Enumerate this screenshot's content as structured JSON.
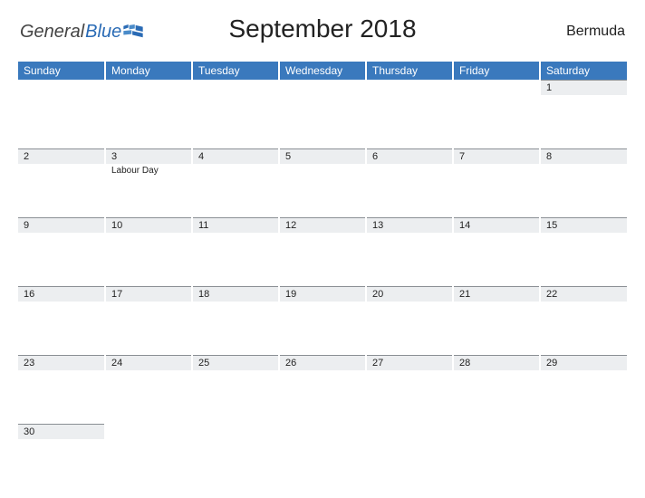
{
  "logo": {
    "text1": "General",
    "text2": "Blue"
  },
  "title": "September 2018",
  "region": "Bermuda",
  "dayHeaders": [
    "Sunday",
    "Monday",
    "Tuesday",
    "Wednesday",
    "Thursday",
    "Friday",
    "Saturday"
  ],
  "weeks": [
    [
      {
        "n": ""
      },
      {
        "n": ""
      },
      {
        "n": ""
      },
      {
        "n": ""
      },
      {
        "n": ""
      },
      {
        "n": ""
      },
      {
        "n": "1"
      }
    ],
    [
      {
        "n": "2"
      },
      {
        "n": "3",
        "event": "Labour Day"
      },
      {
        "n": "4"
      },
      {
        "n": "5"
      },
      {
        "n": "6"
      },
      {
        "n": "7"
      },
      {
        "n": "8"
      }
    ],
    [
      {
        "n": "9"
      },
      {
        "n": "10"
      },
      {
        "n": "11"
      },
      {
        "n": "12"
      },
      {
        "n": "13"
      },
      {
        "n": "14"
      },
      {
        "n": "15"
      }
    ],
    [
      {
        "n": "16"
      },
      {
        "n": "17"
      },
      {
        "n": "18"
      },
      {
        "n": "19"
      },
      {
        "n": "20"
      },
      {
        "n": "21"
      },
      {
        "n": "22"
      }
    ],
    [
      {
        "n": "23"
      },
      {
        "n": "24"
      },
      {
        "n": "25"
      },
      {
        "n": "26"
      },
      {
        "n": "27"
      },
      {
        "n": "28"
      },
      {
        "n": "29"
      }
    ],
    [
      {
        "n": "30"
      },
      {
        "n": ""
      },
      {
        "n": ""
      },
      {
        "n": ""
      },
      {
        "n": ""
      },
      {
        "n": ""
      },
      {
        "n": ""
      }
    ]
  ]
}
